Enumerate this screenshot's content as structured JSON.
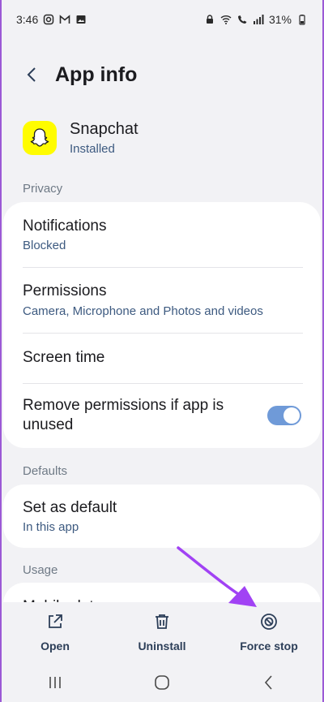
{
  "status_bar": {
    "time": "3:46",
    "battery": "31%"
  },
  "header": {
    "title": "App info"
  },
  "app": {
    "name": "Snapchat",
    "status": "Installed"
  },
  "sections": {
    "privacy": "Privacy",
    "defaults": "Defaults",
    "usage": "Usage"
  },
  "privacy_items": {
    "notifications": {
      "title": "Notifications",
      "subtitle": "Blocked"
    },
    "permissions": {
      "title": "Permissions",
      "subtitle": "Camera, Microphone and Photos and videos"
    },
    "screen_time": {
      "title": "Screen time"
    },
    "remove_permissions": {
      "title": "Remove permissions if app is unused",
      "enabled": true
    }
  },
  "defaults_items": {
    "set_as_default": {
      "title": "Set as default",
      "subtitle": "In this app"
    }
  },
  "usage_items": {
    "mobile_data": {
      "title": "Mobile data"
    }
  },
  "actions": {
    "open": "Open",
    "uninstall": "Uninstall",
    "force_stop": "Force stop"
  },
  "colors": {
    "accent": "#6f9ad8",
    "subtitle": "#3d5a80",
    "annotation": "#a142f4",
    "snapchat_yellow": "#fffc00"
  }
}
